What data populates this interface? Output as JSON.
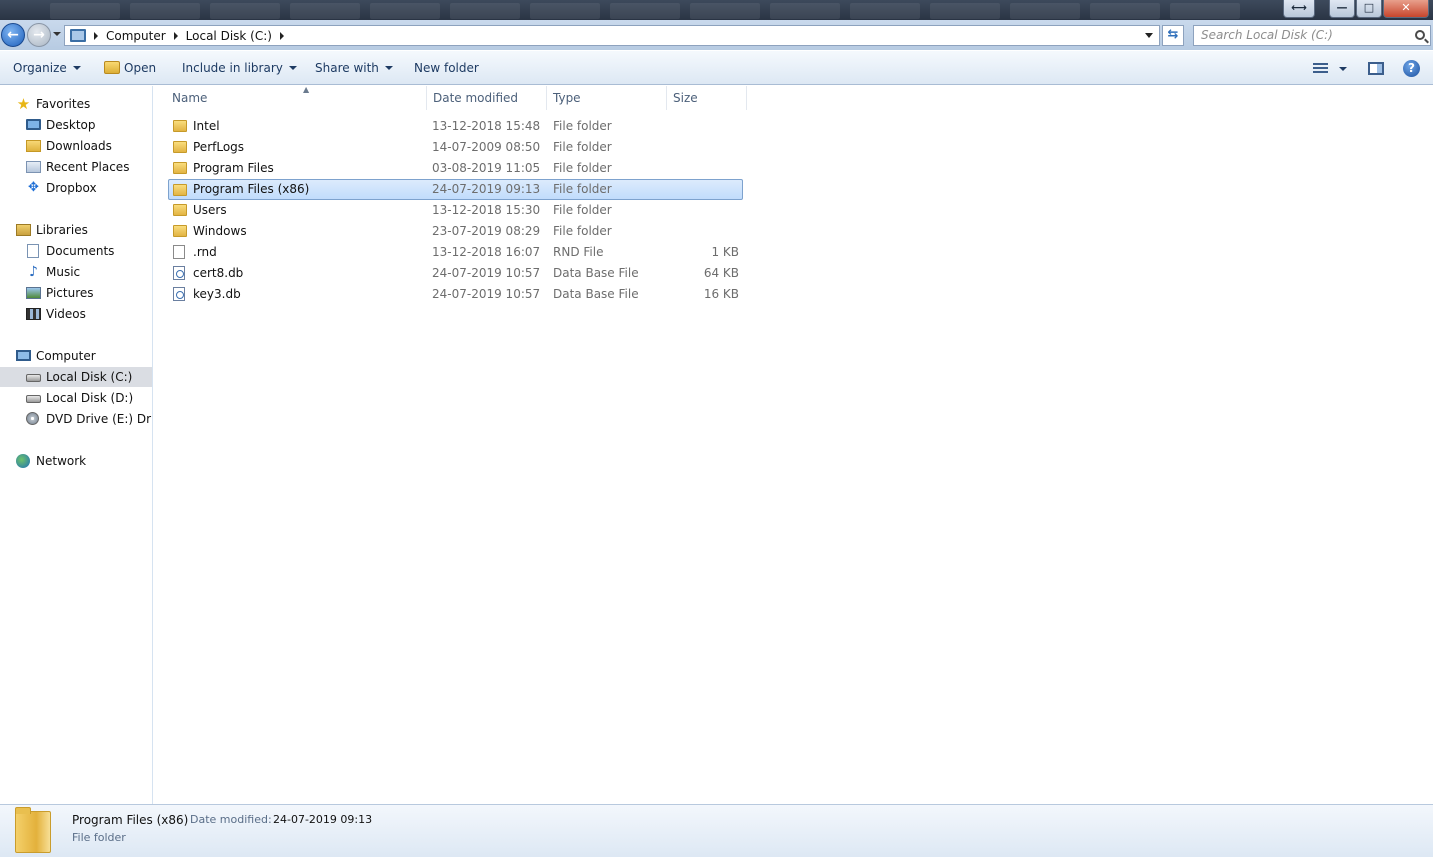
{
  "window": {
    "search_placeholder": "Search Local Disk (C:)",
    "controls": {
      "minimize": "—",
      "maximize": "□",
      "close": "✕"
    }
  },
  "breadcrumb": [
    "Computer",
    "Local Disk (C:)"
  ],
  "toolbar": {
    "organize": "Organize",
    "open": "Open",
    "include_in_library": "Include in library",
    "share_with": "Share with",
    "new_folder": "New folder",
    "help": "?"
  },
  "nav": {
    "favorites": "Favorites",
    "favorites_items": [
      "Desktop",
      "Downloads",
      "Recent Places",
      "Dropbox"
    ],
    "libraries": "Libraries",
    "libraries_items": [
      "Documents",
      "Music",
      "Pictures",
      "Videos"
    ],
    "computer": "Computer",
    "computer_items": [
      "Local Disk (C:)",
      "Local Disk (D:)",
      "DVD Drive (E:) Driver"
    ],
    "selected_item": "Local Disk (C:)",
    "network": "Network"
  },
  "columns": {
    "name": "Name",
    "date": "Date modified",
    "type": "Type",
    "size": "Size"
  },
  "files": [
    {
      "name": "Intel",
      "date": "13-12-2018 15:48",
      "type": "File folder",
      "size": "",
      "icon": "folder-icon"
    },
    {
      "name": "PerfLogs",
      "date": "14-07-2009 08:50",
      "type": "File folder",
      "size": "",
      "icon": "folder-icon"
    },
    {
      "name": "Program Files",
      "date": "03-08-2019 11:05",
      "type": "File folder",
      "size": "",
      "icon": "folder-icon"
    },
    {
      "name": "Program Files (x86)",
      "date": "24-07-2019 09:13",
      "type": "File folder",
      "size": "",
      "icon": "folder-icon",
      "selected": true
    },
    {
      "name": "Users",
      "date": "13-12-2018 15:30",
      "type": "File folder",
      "size": "",
      "icon": "folder-icon"
    },
    {
      "name": "Windows",
      "date": "23-07-2019 08:29",
      "type": "File folder",
      "size": "",
      "icon": "folder-icon"
    },
    {
      "name": ".rnd",
      "date": "13-12-2018 16:07",
      "type": "RND File",
      "size": "1 KB",
      "icon": "blank-file-icon"
    },
    {
      "name": "cert8.db",
      "date": "24-07-2019 10:57",
      "type": "Data Base File",
      "size": "64 KB",
      "icon": "database-file-icon"
    },
    {
      "name": "key3.db",
      "date": "24-07-2019 10:57",
      "type": "Data Base File",
      "size": "16 KB",
      "icon": "database-file-icon"
    }
  ],
  "details": {
    "name": "Program Files (x86)",
    "date_label": "Date modified:",
    "date": "24-07-2019 09:13",
    "type": "File folder"
  },
  "colors": {
    "selection": "#c1dcfc",
    "selection_border": "#7da2ce",
    "toolbar_text": "#1e3b63"
  }
}
